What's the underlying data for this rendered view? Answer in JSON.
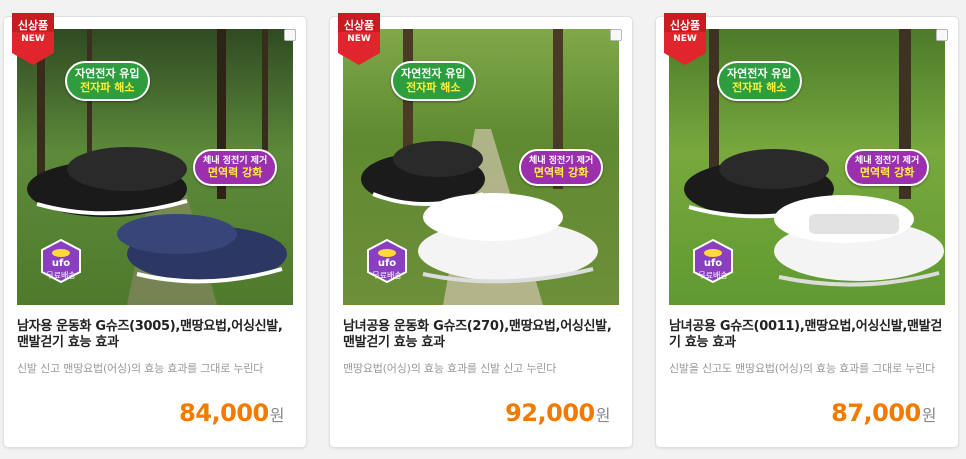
{
  "products": [
    {
      "badge_top": "신상품",
      "badge_bottom": "NEW",
      "bubble_green_line1": "자연전자 유입",
      "bubble_green_line2": "전자파 해소",
      "bubble_purple_line1": "체내 정전기 제거",
      "bubble_purple_line2": "면역력 강화",
      "ufo_line1": "ufo",
      "ufo_line2": "무료배송",
      "title": "남자용 운동화 G슈즈(3005),맨땅요법,어싱신발,맨발걷기 효능 효과",
      "description": "신발 신고 맨땅요법(어싱)의 효능 효과를 그대로 누린다",
      "price": "84,000",
      "currency": "원",
      "shoe_colors": [
        "#1b1b1b",
        "#2c3763"
      ]
    },
    {
      "badge_top": "신상품",
      "badge_bottom": "NEW",
      "bubble_green_line1": "자연전자 유입",
      "bubble_green_line2": "전자파 해소",
      "bubble_purple_line1": "체내 정전기 제거",
      "bubble_purple_line2": "면역력 강화",
      "ufo_line1": "ufo",
      "ufo_line2": "무료배송",
      "title": "남녀공용 운동화 G슈즈(270),맨땅요법,어싱신발,맨발걷기 효능 효과",
      "description": "맨땅요법(어싱)의 효능 효과를 신발 신고 누린다",
      "price": "92,000",
      "currency": "원",
      "shoe_colors": [
        "#1b1b1b",
        "#f4f4f4"
      ]
    },
    {
      "badge_top": "신상품",
      "badge_bottom": "NEW",
      "bubble_green_line1": "자연전자 유입",
      "bubble_green_line2": "전자파 해소",
      "bubble_purple_line1": "체내 정전기 제거",
      "bubble_purple_line2": "면역력 강화",
      "ufo_line1": "ufo",
      "ufo_line2": "무료배송",
      "title": "남녀공용 G슈즈(0011),맨땅요법,어싱신발,맨발걷기 효능 효과",
      "description": "신발을 신고도 맨땅요법(어싱)의 효능 효과를 그대로 누린다",
      "price": "87,000",
      "currency": "원",
      "shoe_colors": [
        "#1b1b1b",
        "#f4f4f4"
      ]
    }
  ],
  "colors": {
    "price": "#f07b00",
    "badge": "#e0262c",
    "bubble_green": "#2e9d3d",
    "bubble_purple": "#9b2fae",
    "ufo": "#8a3fc0"
  }
}
